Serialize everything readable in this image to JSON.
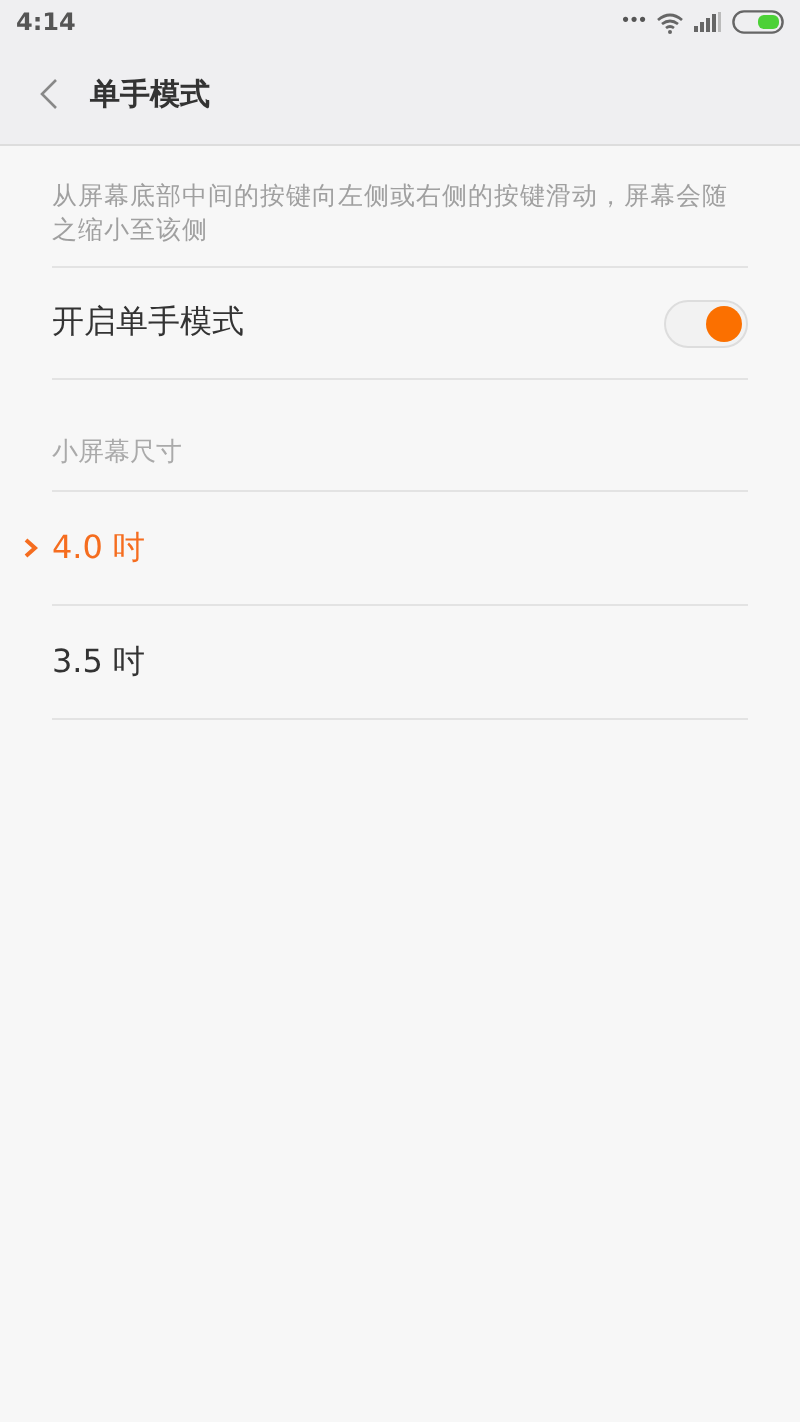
{
  "status_bar": {
    "time": "4:14",
    "more": "•••"
  },
  "header": {
    "title": "单手模式"
  },
  "description": "从屏幕底部中间的按键向左侧或右侧的按键滑动，屏幕会随之缩小至该侧",
  "toggle": {
    "label": "开启单手模式",
    "on": true
  },
  "section": {
    "title": "小屏幕尺寸"
  },
  "options": [
    {
      "label": "4.0 吋",
      "selected": true
    },
    {
      "label": "3.5 吋",
      "selected": false
    }
  ]
}
